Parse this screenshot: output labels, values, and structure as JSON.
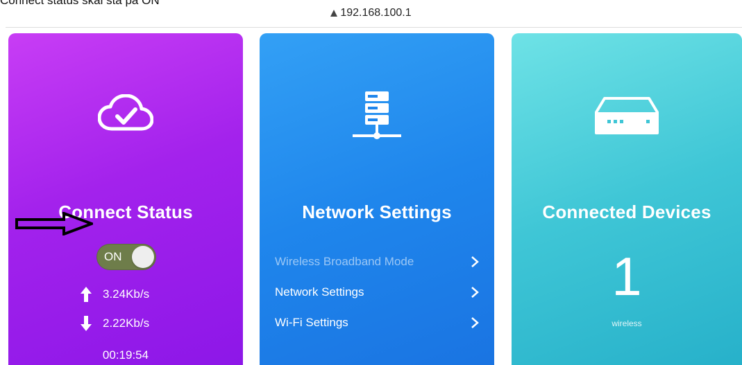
{
  "caption": "Connect status skal stå på ON",
  "browser": {
    "url": "192.168.100.1",
    "lock_icon": "lock-icon"
  },
  "cards": {
    "connect_status": {
      "title": "Connect Status",
      "icon": "cloud-check-icon",
      "toggle_label": "ON",
      "toggle_on": true,
      "upload_speed": "3.24Kb/s",
      "download_speed": "2.22Kb/s",
      "connected_time": "00:19:54",
      "color": "#a322ec"
    },
    "network_settings": {
      "title": "Network Settings",
      "icon": "server-icon",
      "color": "#1f86ec",
      "items": [
        {
          "label": "Wireless Broadband Mode"
        },
        {
          "label": "Network Settings"
        },
        {
          "label": "Wi-Fi Settings"
        }
      ]
    },
    "connected_devices": {
      "title": "Connected Devices",
      "icon": "router-icon",
      "count": "1",
      "type": "wireless",
      "color": "#3fc6d6"
    }
  },
  "annotation": {
    "icon": "arrow-right-outline-icon"
  }
}
